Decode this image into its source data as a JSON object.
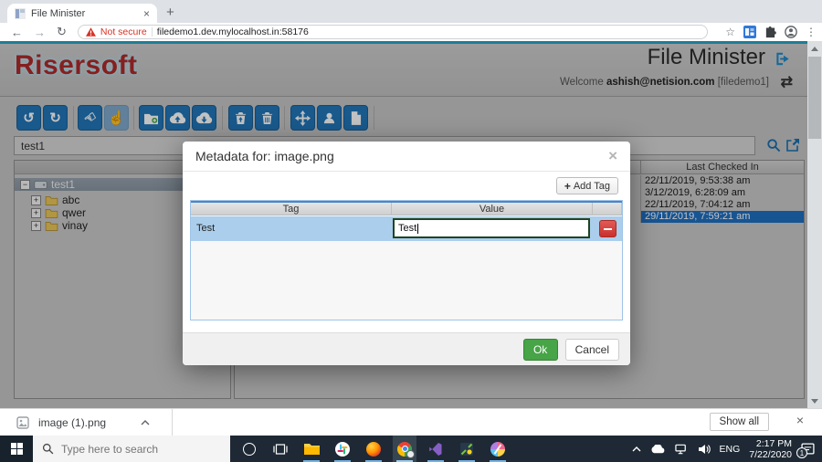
{
  "browser": {
    "tab_title": "File Minister",
    "close_tab": "×",
    "new_tab": "+",
    "back": "←",
    "forward": "→",
    "reload": "↻",
    "warning_label": "Not secure",
    "url": "filedemo1.dev.mylocalhost.in:58176",
    "star": "☆",
    "menu_dots": "⋮"
  },
  "page": {
    "logo": "Risersoft",
    "title": "File Minister",
    "welcome_prefix": "Welcome",
    "welcome_user": "ashish@netision.com",
    "welcome_org": "[filedemo1]",
    "swap_glyph": "⇄",
    "search_value": "test1",
    "toolbar_icons": [
      "history",
      "refresh",
      "check-out",
      "check-in",
      "new-folder",
      "upload",
      "download",
      "restore",
      "delete",
      "move",
      "user",
      "new-file"
    ],
    "icon_glyphs": {
      "history": "↺",
      "refresh": "↻",
      "check_out": "☜",
      "check_in": "☝"
    }
  },
  "tree": {
    "root": "test1",
    "children": [
      "abc",
      "qwer",
      "vinay"
    ]
  },
  "grid": {
    "header": "Last Checked In",
    "rows": [
      "22/11/2019, 9:53:38 am",
      "3/12/2019, 6:28:09 am",
      "22/11/2019, 7:04:12 am",
      "29/11/2019, 7:59:21 am"
    ],
    "selected_row": "29/11/2019, 7:59:21 am"
  },
  "modal": {
    "title": "Metadata for: image.png",
    "close": "×",
    "add_tag_plus": "+",
    "add_tag": "Add Tag",
    "col_tag": "Tag",
    "col_value": "Value",
    "row_tag": "Test",
    "row_value": "Test",
    "ok": "Ok",
    "cancel": "Cancel"
  },
  "shelf": {
    "filename": "image (1).png",
    "show_all": "Show all",
    "close": "×"
  },
  "taskbar": {
    "search_placeholder": "Type here to search",
    "language": "ENG",
    "time": "2:17 PM",
    "date": "7/22/2020",
    "badge_count": "1"
  },
  "colors": {
    "toolbar_button": "#2176b8",
    "selection_blue": "#1f6fc0",
    "ok_green": "#47a447",
    "delete_red": "#c9302c",
    "teal_strip": "#25a5c4",
    "logo_red": "#b02a2a",
    "not_secure_red": "#d93025"
  }
}
